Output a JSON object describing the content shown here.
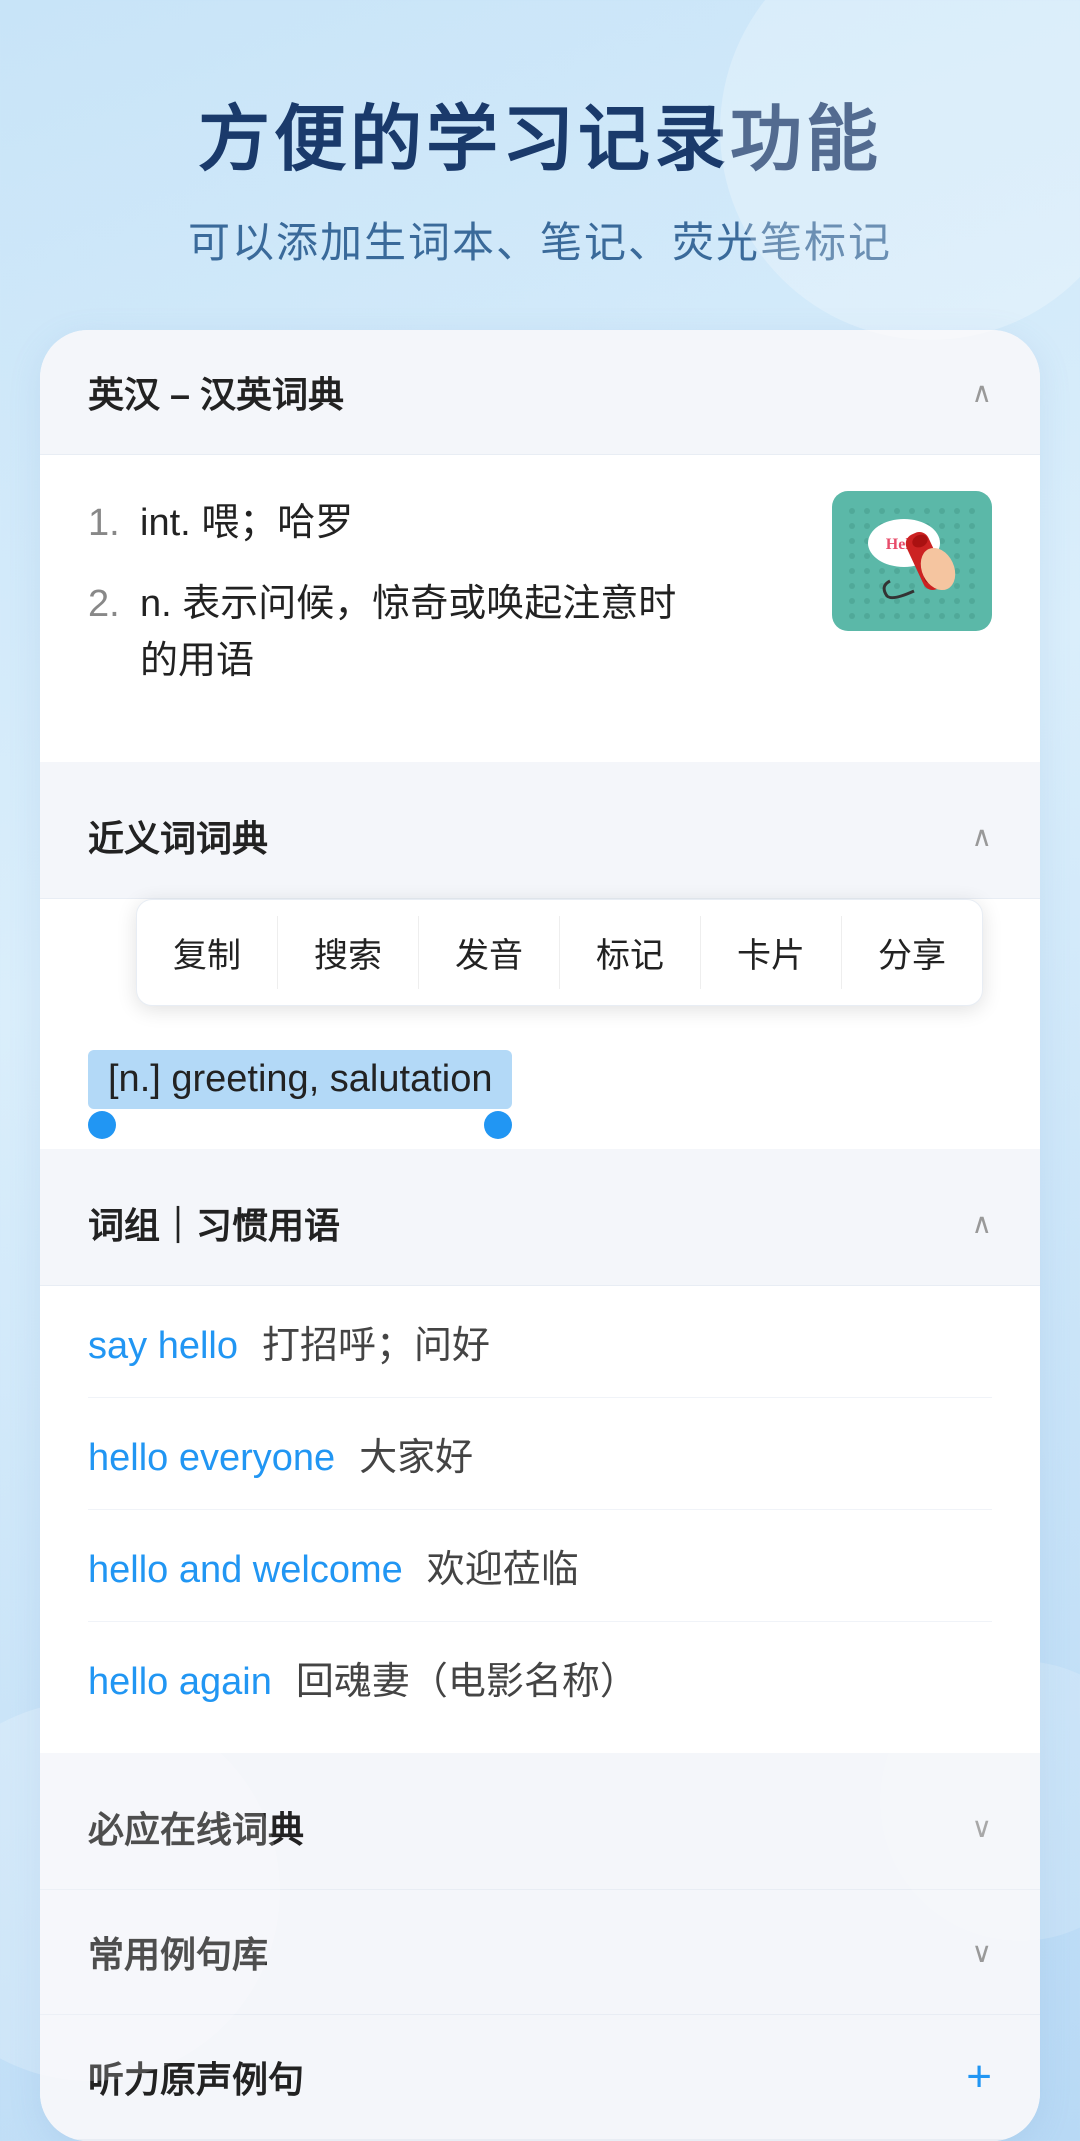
{
  "header": {
    "title": "方便的学习记录功能",
    "subtitle": "可以添加生词本、笔记、荧光笔标记"
  },
  "dict_section": {
    "title": "英汉 – 汉英词典",
    "chevron": "∧",
    "entries": [
      {
        "num": "1.",
        "text": "int. 喂；哈罗"
      },
      {
        "num": "2.",
        "text": "n. 表示问候，惊奇或唤起注意时的用语"
      }
    ]
  },
  "synonyms_section": {
    "title": "近义词词典",
    "chevron": "∧",
    "context_menu": [
      "复制",
      "搜索",
      "发音",
      "标记",
      "卡片",
      "分享"
    ],
    "selected_text": "[n.] greeting, salutation"
  },
  "phrases_section": {
    "title": "词组｜习惯用语",
    "chevron": "∧",
    "phrases": [
      {
        "en": "say hello",
        "zh": "打招呼；问好"
      },
      {
        "en": "hello everyone",
        "zh": "大家好"
      },
      {
        "en": "hello and welcome",
        "zh": "欢迎莅临"
      },
      {
        "en": "hello again",
        "zh": "回魂妻（电影名称）"
      }
    ]
  },
  "collapsed_sections": [
    {
      "title": "必应在线词典",
      "chevron": "∨",
      "has_plus": false
    },
    {
      "title": "常用例句库",
      "chevron": "∨",
      "has_plus": false
    },
    {
      "title": "听力原声例句",
      "chevron": "",
      "has_plus": true
    }
  ]
}
